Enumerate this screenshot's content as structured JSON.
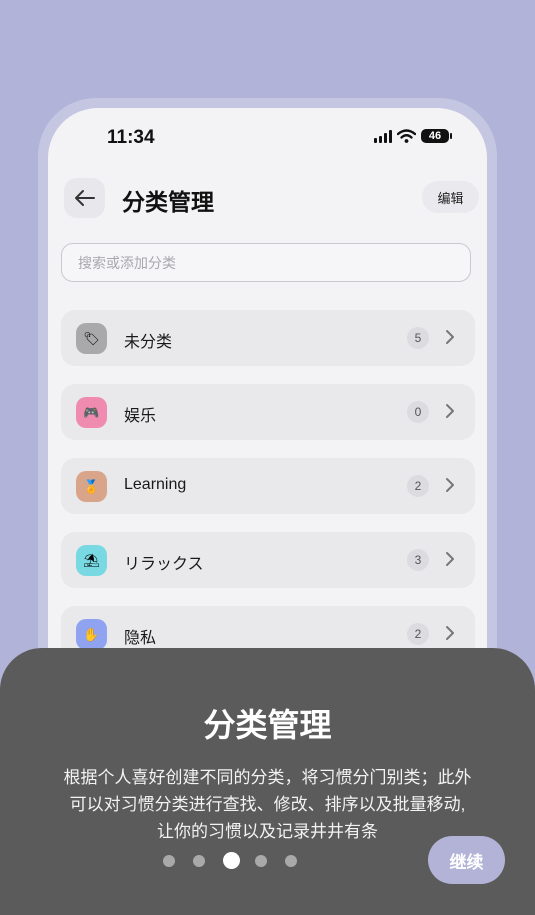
{
  "status_bar": {
    "time": "11:34",
    "battery": "46"
  },
  "header": {
    "title": "分类管理",
    "edit_label": "编辑"
  },
  "search": {
    "placeholder": "搜索或添加分类"
  },
  "categories": [
    {
      "name": "未分类",
      "count": "5",
      "icon": "tag-icon",
      "glyph": "🏷",
      "color": "#a9a9ac"
    },
    {
      "name": "娱乐",
      "count": "0",
      "icon": "game-controller-icon",
      "glyph": "🎮",
      "color": "#f08bb0"
    },
    {
      "name": "Learning",
      "count": "2",
      "icon": "medal-icon",
      "glyph": "🏅",
      "color": "#d9a58a"
    },
    {
      "name": "リラックス",
      "count": "3",
      "icon": "beach-umbrella-icon",
      "glyph": "⛱",
      "color": "#79d9e3"
    },
    {
      "name": "隐私",
      "count": "2",
      "icon": "hand-icon",
      "glyph": "✋",
      "color": "#8fa3f0"
    }
  ],
  "onboarding": {
    "title": "分类管理",
    "desc_lines": [
      "根据个人喜好创建不同的分类，将习惯分门别类；此外",
      "可以对习惯分类进行查找、修改、排序以及批量移动,",
      "让你的习惯以及记录井井有条"
    ],
    "continue_label": "继续",
    "page_count": 5,
    "active_page": 3
  }
}
